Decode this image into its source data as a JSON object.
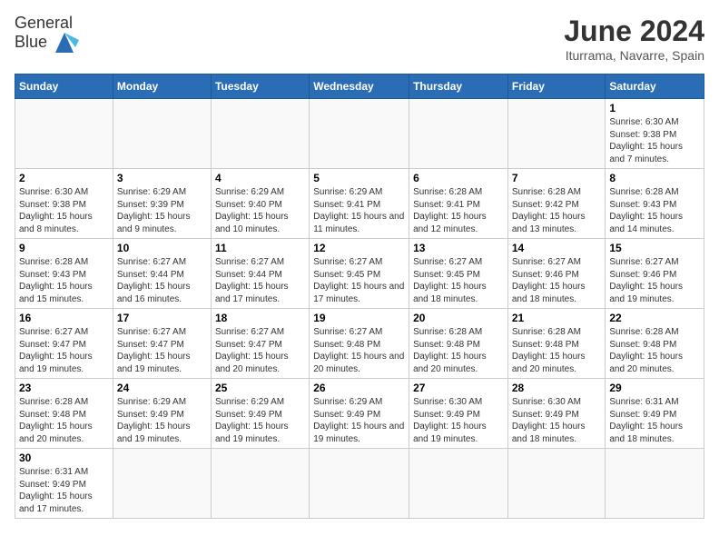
{
  "header": {
    "logo_line1": "General",
    "logo_line2": "Blue",
    "title": "June 2024",
    "subtitle": "Iturrama, Navarre, Spain"
  },
  "days_of_week": [
    "Sunday",
    "Monday",
    "Tuesday",
    "Wednesday",
    "Thursday",
    "Friday",
    "Saturday"
  ],
  "weeks": [
    [
      {
        "day": "",
        "info": ""
      },
      {
        "day": "",
        "info": ""
      },
      {
        "day": "",
        "info": ""
      },
      {
        "day": "",
        "info": ""
      },
      {
        "day": "",
        "info": ""
      },
      {
        "day": "",
        "info": ""
      },
      {
        "day": "1",
        "info": "Sunrise: 6:30 AM\nSunset: 9:38 PM\nDaylight: 15 hours and 7 minutes."
      }
    ],
    [
      {
        "day": "2",
        "info": "Sunrise: 6:30 AM\nSunset: 9:38 PM\nDaylight: 15 hours and 8 minutes."
      },
      {
        "day": "3",
        "info": "Sunrise: 6:29 AM\nSunset: 9:39 PM\nDaylight: 15 hours and 9 minutes."
      },
      {
        "day": "4",
        "info": "Sunrise: 6:29 AM\nSunset: 9:40 PM\nDaylight: 15 hours and 10 minutes."
      },
      {
        "day": "5",
        "info": "Sunrise: 6:29 AM\nSunset: 9:41 PM\nDaylight: 15 hours and 11 minutes."
      },
      {
        "day": "6",
        "info": "Sunrise: 6:28 AM\nSunset: 9:41 PM\nDaylight: 15 hours and 12 minutes."
      },
      {
        "day": "7",
        "info": "Sunrise: 6:28 AM\nSunset: 9:42 PM\nDaylight: 15 hours and 13 minutes."
      },
      {
        "day": "8",
        "info": "Sunrise: 6:28 AM\nSunset: 9:43 PM\nDaylight: 15 hours and 14 minutes."
      }
    ],
    [
      {
        "day": "9",
        "info": "Sunrise: 6:28 AM\nSunset: 9:43 PM\nDaylight: 15 hours and 15 minutes."
      },
      {
        "day": "10",
        "info": "Sunrise: 6:27 AM\nSunset: 9:44 PM\nDaylight: 15 hours and 16 minutes."
      },
      {
        "day": "11",
        "info": "Sunrise: 6:27 AM\nSunset: 9:44 PM\nDaylight: 15 hours and 17 minutes."
      },
      {
        "day": "12",
        "info": "Sunrise: 6:27 AM\nSunset: 9:45 PM\nDaylight: 15 hours and 17 minutes."
      },
      {
        "day": "13",
        "info": "Sunrise: 6:27 AM\nSunset: 9:45 PM\nDaylight: 15 hours and 18 minutes."
      },
      {
        "day": "14",
        "info": "Sunrise: 6:27 AM\nSunset: 9:46 PM\nDaylight: 15 hours and 18 minutes."
      },
      {
        "day": "15",
        "info": "Sunrise: 6:27 AM\nSunset: 9:46 PM\nDaylight: 15 hours and 19 minutes."
      }
    ],
    [
      {
        "day": "16",
        "info": "Sunrise: 6:27 AM\nSunset: 9:47 PM\nDaylight: 15 hours and 19 minutes."
      },
      {
        "day": "17",
        "info": "Sunrise: 6:27 AM\nSunset: 9:47 PM\nDaylight: 15 hours and 19 minutes."
      },
      {
        "day": "18",
        "info": "Sunrise: 6:27 AM\nSunset: 9:47 PM\nDaylight: 15 hours and 20 minutes."
      },
      {
        "day": "19",
        "info": "Sunrise: 6:27 AM\nSunset: 9:48 PM\nDaylight: 15 hours and 20 minutes."
      },
      {
        "day": "20",
        "info": "Sunrise: 6:28 AM\nSunset: 9:48 PM\nDaylight: 15 hours and 20 minutes."
      },
      {
        "day": "21",
        "info": "Sunrise: 6:28 AM\nSunset: 9:48 PM\nDaylight: 15 hours and 20 minutes."
      },
      {
        "day": "22",
        "info": "Sunrise: 6:28 AM\nSunset: 9:48 PM\nDaylight: 15 hours and 20 minutes."
      }
    ],
    [
      {
        "day": "23",
        "info": "Sunrise: 6:28 AM\nSunset: 9:48 PM\nDaylight: 15 hours and 20 minutes."
      },
      {
        "day": "24",
        "info": "Sunrise: 6:29 AM\nSunset: 9:49 PM\nDaylight: 15 hours and 19 minutes."
      },
      {
        "day": "25",
        "info": "Sunrise: 6:29 AM\nSunset: 9:49 PM\nDaylight: 15 hours and 19 minutes."
      },
      {
        "day": "26",
        "info": "Sunrise: 6:29 AM\nSunset: 9:49 PM\nDaylight: 15 hours and 19 minutes."
      },
      {
        "day": "27",
        "info": "Sunrise: 6:30 AM\nSunset: 9:49 PM\nDaylight: 15 hours and 19 minutes."
      },
      {
        "day": "28",
        "info": "Sunrise: 6:30 AM\nSunset: 9:49 PM\nDaylight: 15 hours and 18 minutes."
      },
      {
        "day": "29",
        "info": "Sunrise: 6:31 AM\nSunset: 9:49 PM\nDaylight: 15 hours and 18 minutes."
      }
    ],
    [
      {
        "day": "30",
        "info": "Sunrise: 6:31 AM\nSunset: 9:49 PM\nDaylight: 15 hours and 17 minutes."
      },
      {
        "day": "",
        "info": ""
      },
      {
        "day": "",
        "info": ""
      },
      {
        "day": "",
        "info": ""
      },
      {
        "day": "",
        "info": ""
      },
      {
        "day": "",
        "info": ""
      },
      {
        "day": "",
        "info": ""
      }
    ]
  ]
}
